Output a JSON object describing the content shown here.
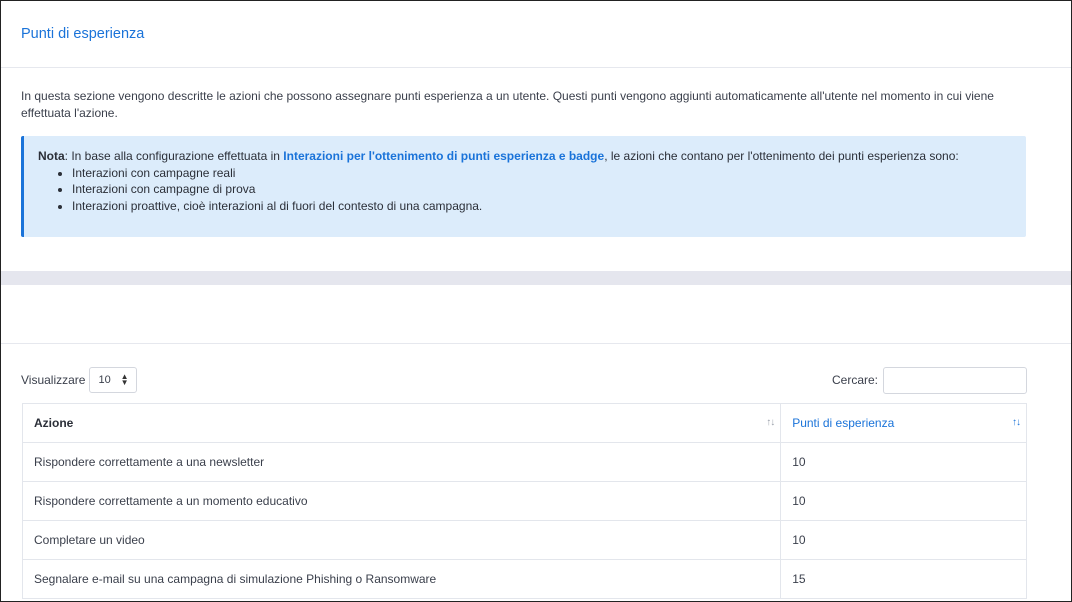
{
  "header": {
    "title": "Punti di esperienza"
  },
  "intro": "In questa sezione vengono descritte le azioni che possono assegnare punti esperienza a un utente. Questi punti vengono aggiunti automaticamente all'utente nel momento in cui viene effettuata l'azione.",
  "note": {
    "label": "Nota",
    "text_before": ": In base alla configurazione effettuata in ",
    "link": "Interazioni per l'ottenimento di punti esperienza e badge",
    "text_after": ", le azioni che contano per l'ottenimento dei punti esperienza sono:",
    "items": [
      "Interazioni con campagne reali",
      "Interazioni con campagne di prova",
      "Interazioni proattive, cioè interazioni al di fuori del contesto di una campagna."
    ]
  },
  "table_controls": {
    "show_label": "Visualizzare",
    "page_size": "10",
    "search_label": "Cercare:",
    "search_value": ""
  },
  "table": {
    "columns": [
      "Azione",
      "Punti di esperienza"
    ],
    "rows": [
      [
        "Rispondere correttamente a una newsletter",
        "10"
      ],
      [
        "Rispondere correttamente a un momento educativo",
        "10"
      ],
      [
        "Completare un video",
        "10"
      ],
      [
        "Segnalare e-mail su una campagna di simulazione Phishing o Ransomware",
        "15"
      ]
    ]
  },
  "colors": {
    "accent": "#1a73d9",
    "note_bg": "#dcecfb"
  }
}
